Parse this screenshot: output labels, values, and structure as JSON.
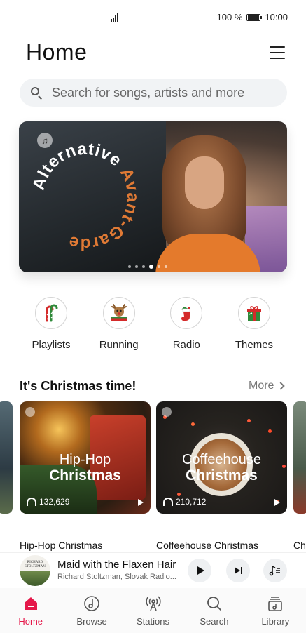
{
  "status": {
    "battery": "100 %",
    "time": "10:00"
  },
  "header": {
    "title": "Home"
  },
  "search": {
    "placeholder": "Search for songs, artists and more"
  },
  "banner": {
    "ring_text": "Alternative Avant-Garde",
    "ring_white": "Alternative",
    "ring_orange": "Avant-Garde",
    "active_slide": 4,
    "slide_count": 6
  },
  "shortcuts": [
    {
      "label": "Playlists",
      "icon": "candy-cane-icon"
    },
    {
      "label": "Running",
      "icon": "reindeer-icon"
    },
    {
      "label": "Radio",
      "icon": "stocking-icon"
    },
    {
      "label": "Themes",
      "icon": "gift-icon"
    }
  ],
  "section": {
    "title": "It's Christmas time!",
    "more_label": "More"
  },
  "cards": [
    {
      "art_line1": "Hip-Hop",
      "art_line2": "Christmas",
      "plays": "132,629",
      "name": "Hip-Hop Christmas"
    },
    {
      "art_line1": "Coffeehouse",
      "art_line2": "Christmas",
      "plays": "210,712",
      "name": "Coffeehouse Christmas"
    }
  ],
  "edge_card": {
    "name_fragment": "Ch"
  },
  "now_playing": {
    "title": "Maid with the Flaxen Hair",
    "artist": "Richard Stoltzman, Slovak Radio...",
    "cover_text": "RICHARD STOLTZMAN"
  },
  "tabs": [
    {
      "label": "Home",
      "icon": "home-icon",
      "active": true
    },
    {
      "label": "Browse",
      "icon": "music-disc-icon",
      "active": false
    },
    {
      "label": "Stations",
      "icon": "broadcast-icon",
      "active": false
    },
    {
      "label": "Search",
      "icon": "search-icon",
      "active": false
    },
    {
      "label": "Library",
      "icon": "library-icon",
      "active": false
    }
  ],
  "colors": {
    "accent": "#e5184a",
    "banner_orange": "#e07a35"
  }
}
